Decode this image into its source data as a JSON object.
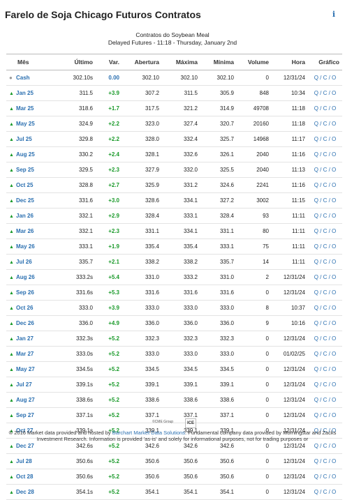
{
  "page": {
    "title": "Farelo de Soja Chicago Futuros Contratos",
    "info_icon": "i",
    "subtitle1": "Contratos do Soybean Meal",
    "subtitle2": "Delayed Futures - 11:18 - Thursday, January 2nd"
  },
  "table": {
    "headers": [
      "Mês",
      "Último",
      "Var.",
      "Abertura",
      "Máxima",
      "Mínima",
      "Volume",
      "Hora",
      "Gráfico"
    ],
    "rows": [
      {
        "symbol": "Cash",
        "last": "302.10s",
        "chg": "0.00",
        "open": "302.10",
        "high": "302.10",
        "low": "302.10",
        "vol": "0",
        "time": "12/31/24",
        "links": "Q / C / O",
        "icon": "dot"
      },
      {
        "symbol": "Jan 25",
        "last": "311.5",
        "chg": "+3.9",
        "open": "307.2",
        "high": "311.5",
        "low": "305.9",
        "vol": "848",
        "time": "10:34",
        "links": "Q / C / O",
        "icon": "up"
      },
      {
        "symbol": "Mar 25",
        "last": "318.6",
        "chg": "+1.7",
        "open": "317.5",
        "high": "321.2",
        "low": "314.9",
        "vol": "49708",
        "time": "11:18",
        "links": "Q / C / O",
        "icon": "up"
      },
      {
        "symbol": "May 25",
        "last": "324.9",
        "chg": "+2.2",
        "open": "323.0",
        "high": "327.4",
        "low": "320.7",
        "vol": "20160",
        "time": "11:18",
        "links": "Q / C / O",
        "icon": "up"
      },
      {
        "symbol": "Jul 25",
        "last": "329.8",
        "chg": "+2.2",
        "open": "328.0",
        "high": "332.4",
        "low": "325.7",
        "vol": "14968",
        "time": "11:17",
        "links": "Q / C / O",
        "icon": "up"
      },
      {
        "symbol": "Aug 25",
        "last": "330.2",
        "chg": "+2.4",
        "open": "328.1",
        "high": "332.6",
        "low": "326.1",
        "vol": "2040",
        "time": "11:16",
        "links": "Q / C / O",
        "icon": "up"
      },
      {
        "symbol": "Sep 25",
        "last": "329.5",
        "chg": "+2.3",
        "open": "327.9",
        "high": "332.0",
        "low": "325.5",
        "vol": "2040",
        "time": "11:13",
        "links": "Q / C / O",
        "icon": "up"
      },
      {
        "symbol": "Oct 25",
        "last": "328.8",
        "chg": "+2.7",
        "open": "325.9",
        "high": "331.2",
        "low": "324.6",
        "vol": "2241",
        "time": "11:16",
        "links": "Q / C / O",
        "icon": "up"
      },
      {
        "symbol": "Dec 25",
        "last": "331.6",
        "chg": "+3.0",
        "open": "328.6",
        "high": "334.1",
        "low": "327.2",
        "vol": "3002",
        "time": "11:15",
        "links": "Q / C / O",
        "icon": "up"
      },
      {
        "symbol": "Jan 26",
        "last": "332.1",
        "chg": "+2.9",
        "open": "328.4",
        "high": "333.1",
        "low": "328.4",
        "vol": "93",
        "time": "11:11",
        "links": "Q / C / O",
        "icon": "up"
      },
      {
        "symbol": "Mar 26",
        "last": "332.1",
        "chg": "+2.3",
        "open": "331.1",
        "high": "334.1",
        "low": "331.1",
        "vol": "80",
        "time": "11:11",
        "links": "Q / C / O",
        "icon": "up"
      },
      {
        "symbol": "May 26",
        "last": "333.1",
        "chg": "+1.9",
        "open": "335.4",
        "high": "335.4",
        "low": "333.1",
        "vol": "75",
        "time": "11:11",
        "links": "Q / C / O",
        "icon": "up"
      },
      {
        "symbol": "Jul 26",
        "last": "335.7",
        "chg": "+2.1",
        "open": "338.2",
        "high": "338.2",
        "low": "335.7",
        "vol": "14",
        "time": "11:11",
        "links": "Q / C / O",
        "icon": "up"
      },
      {
        "symbol": "Aug 26",
        "last": "333.2s",
        "chg": "+5.4",
        "open": "331.0",
        "high": "333.2",
        "low": "331.0",
        "vol": "2",
        "time": "12/31/24",
        "links": "Q / C / O",
        "icon": "up"
      },
      {
        "symbol": "Sep 26",
        "last": "331.6s",
        "chg": "+5.3",
        "open": "331.6",
        "high": "331.6",
        "low": "331.6",
        "vol": "0",
        "time": "12/31/24",
        "links": "Q / C / O",
        "icon": "up"
      },
      {
        "symbol": "Oct 26",
        "last": "333.0",
        "chg": "+3.9",
        "open": "333.0",
        "high": "333.0",
        "low": "333.0",
        "vol": "8",
        "time": "10:37",
        "links": "Q / C / O",
        "icon": "up"
      },
      {
        "symbol": "Dec 26",
        "last": "336.0",
        "chg": "+4.9",
        "open": "336.0",
        "high": "336.0",
        "low": "336.0",
        "vol": "9",
        "time": "10:16",
        "links": "Q / C / O",
        "icon": "up"
      },
      {
        "symbol": "Jan 27",
        "last": "332.3s",
        "chg": "+5.2",
        "open": "332.3",
        "high": "332.3",
        "low": "332.3",
        "vol": "0",
        "time": "12/31/24",
        "links": "Q / C / O",
        "icon": "up"
      },
      {
        "symbol": "Mar 27",
        "last": "333.0s",
        "chg": "+5.2",
        "open": "333.0",
        "high": "333.0",
        "low": "333.0",
        "vol": "0",
        "time": "01/02/25",
        "links": "Q / C / O",
        "icon": "up"
      },
      {
        "symbol": "May 27",
        "last": "334.5s",
        "chg": "+5.2",
        "open": "334.5",
        "high": "334.5",
        "low": "334.5",
        "vol": "0",
        "time": "12/31/24",
        "links": "Q / C / O",
        "icon": "up"
      },
      {
        "symbol": "Jul 27",
        "last": "339.1s",
        "chg": "+5.2",
        "open": "339.1",
        "high": "339.1",
        "low": "339.1",
        "vol": "0",
        "time": "12/31/24",
        "links": "Q / C / O",
        "icon": "up"
      },
      {
        "symbol": "Aug 27",
        "last": "338.6s",
        "chg": "+5.2",
        "open": "338.6",
        "high": "338.6",
        "low": "338.6",
        "vol": "0",
        "time": "12/31/24",
        "links": "Q / C / O",
        "icon": "up"
      },
      {
        "symbol": "Sep 27",
        "last": "337.1s",
        "chg": "+5.2",
        "open": "337.1",
        "high": "337.1",
        "low": "337.1",
        "vol": "0",
        "time": "12/31/24",
        "links": "Q / C / O",
        "icon": "up"
      },
      {
        "symbol": "Oct 27",
        "last": "339.1s",
        "chg": "+5.2",
        "open": "339.1",
        "high": "339.1",
        "low": "339.1",
        "vol": "0",
        "time": "12/31/24",
        "links": "Q / C / O",
        "icon": "up"
      },
      {
        "symbol": "Dec 27",
        "last": "342.6s",
        "chg": "+5.2",
        "open": "342.6",
        "high": "342.6",
        "low": "342.6",
        "vol": "0",
        "time": "12/31/24",
        "links": "Q / C / O",
        "icon": "up"
      },
      {
        "symbol": "Jul 28",
        "last": "350.6s",
        "chg": "+5.2",
        "open": "350.6",
        "high": "350.6",
        "low": "350.6",
        "vol": "0",
        "time": "12/31/24",
        "links": "Q / C / O",
        "icon": "up"
      },
      {
        "symbol": "Oct 28",
        "last": "350.6s",
        "chg": "+5.2",
        "open": "350.6",
        "high": "350.6",
        "low": "350.6",
        "vol": "0",
        "time": "12/31/24",
        "links": "Q / C / O",
        "icon": "up"
      },
      {
        "symbol": "Dec 28",
        "last": "354.1s",
        "chg": "+5.2",
        "open": "354.1",
        "high": "354.1",
        "low": "354.1",
        "vol": "0",
        "time": "12/31/24",
        "links": "Q / C / O",
        "icon": "up"
      }
    ]
  },
  "footer": {
    "logo_text": "©CME Group",
    "ice_text": "ICE",
    "text_before_link": "© 2016 Market data provided and hosted by ",
    "link_text": "Barchart Market Data Solutions",
    "text_after_link": ". Fundamental company data provided by Morningstar and Zacks Investment Research. Information is provided 'as-is' and solely for informational purposes, not for trading purposes or"
  },
  "colors": {
    "symbol": "#2a6fb0",
    "positive": "#1a9a2a",
    "link": "#2a6fb0"
  }
}
